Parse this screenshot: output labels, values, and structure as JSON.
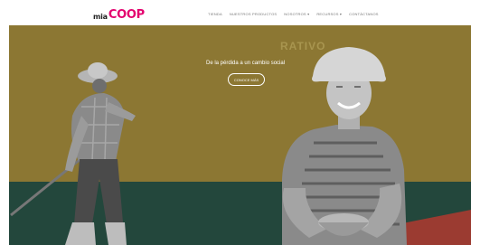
{
  "header": {
    "logo_prefix": "mia",
    "logo_brand": "COOP",
    "nav": [
      {
        "label": "Tienda"
      },
      {
        "label": "Nuestros productos"
      },
      {
        "label": "Nosotros ▾"
      },
      {
        "label": "Recursos ▾"
      },
      {
        "label": "Contáctanos"
      }
    ]
  },
  "hero": {
    "watermark": "RATIVO",
    "tagline": "De la pérdida a un cambio social",
    "cta_label": "Conoce más"
  },
  "colors": {
    "brand_pink": "#e3006e",
    "hero_mustard": "#8c7733",
    "hero_green": "#23473c",
    "hero_red": "#9b3b31"
  }
}
